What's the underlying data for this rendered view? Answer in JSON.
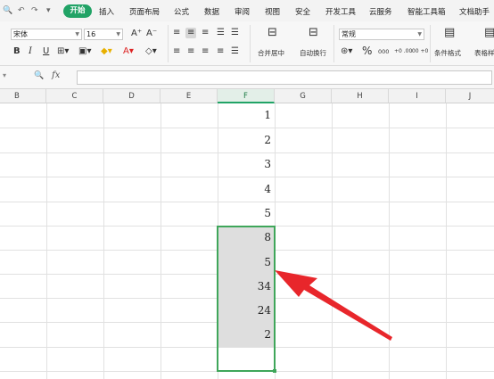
{
  "quick_access": [
    "undo",
    "redo",
    "more"
  ],
  "menu": {
    "active_tab": "开始",
    "tabs": [
      "插入",
      "页面布局",
      "公式",
      "数据",
      "审阅",
      "视图",
      "安全",
      "开发工具",
      "云服务",
      "智能工具箱",
      "文档助手"
    ]
  },
  "ribbon": {
    "font_name": "宋体",
    "font_size": "16",
    "number_format": "常规",
    "merge_label": "合并居中",
    "wrap_label": "自动换行",
    "cond_format_label": "条件格式",
    "table_style_label": "表格样",
    "percent_symbol": "%",
    "thousands_symbol": "000",
    "inc_decimal": "+0 .00",
    "dec_decimal": ".00 +0"
  },
  "formula_bar": {
    "zoom_icon": "🔍",
    "fx": "fx",
    "value": ""
  },
  "columns": [
    "B",
    "C",
    "D",
    "E",
    "F",
    "G",
    "H",
    "I",
    "J"
  ],
  "selected_column": "F",
  "cells_f": [
    "1",
    "2",
    "3",
    "4",
    "5",
    "8",
    "5",
    "34",
    "24",
    "2",
    ""
  ],
  "colors": {
    "accent": "#21a366",
    "selection_border": "#3fa65a",
    "arrow": "#e8262b",
    "selection_fill": "#dedede"
  }
}
